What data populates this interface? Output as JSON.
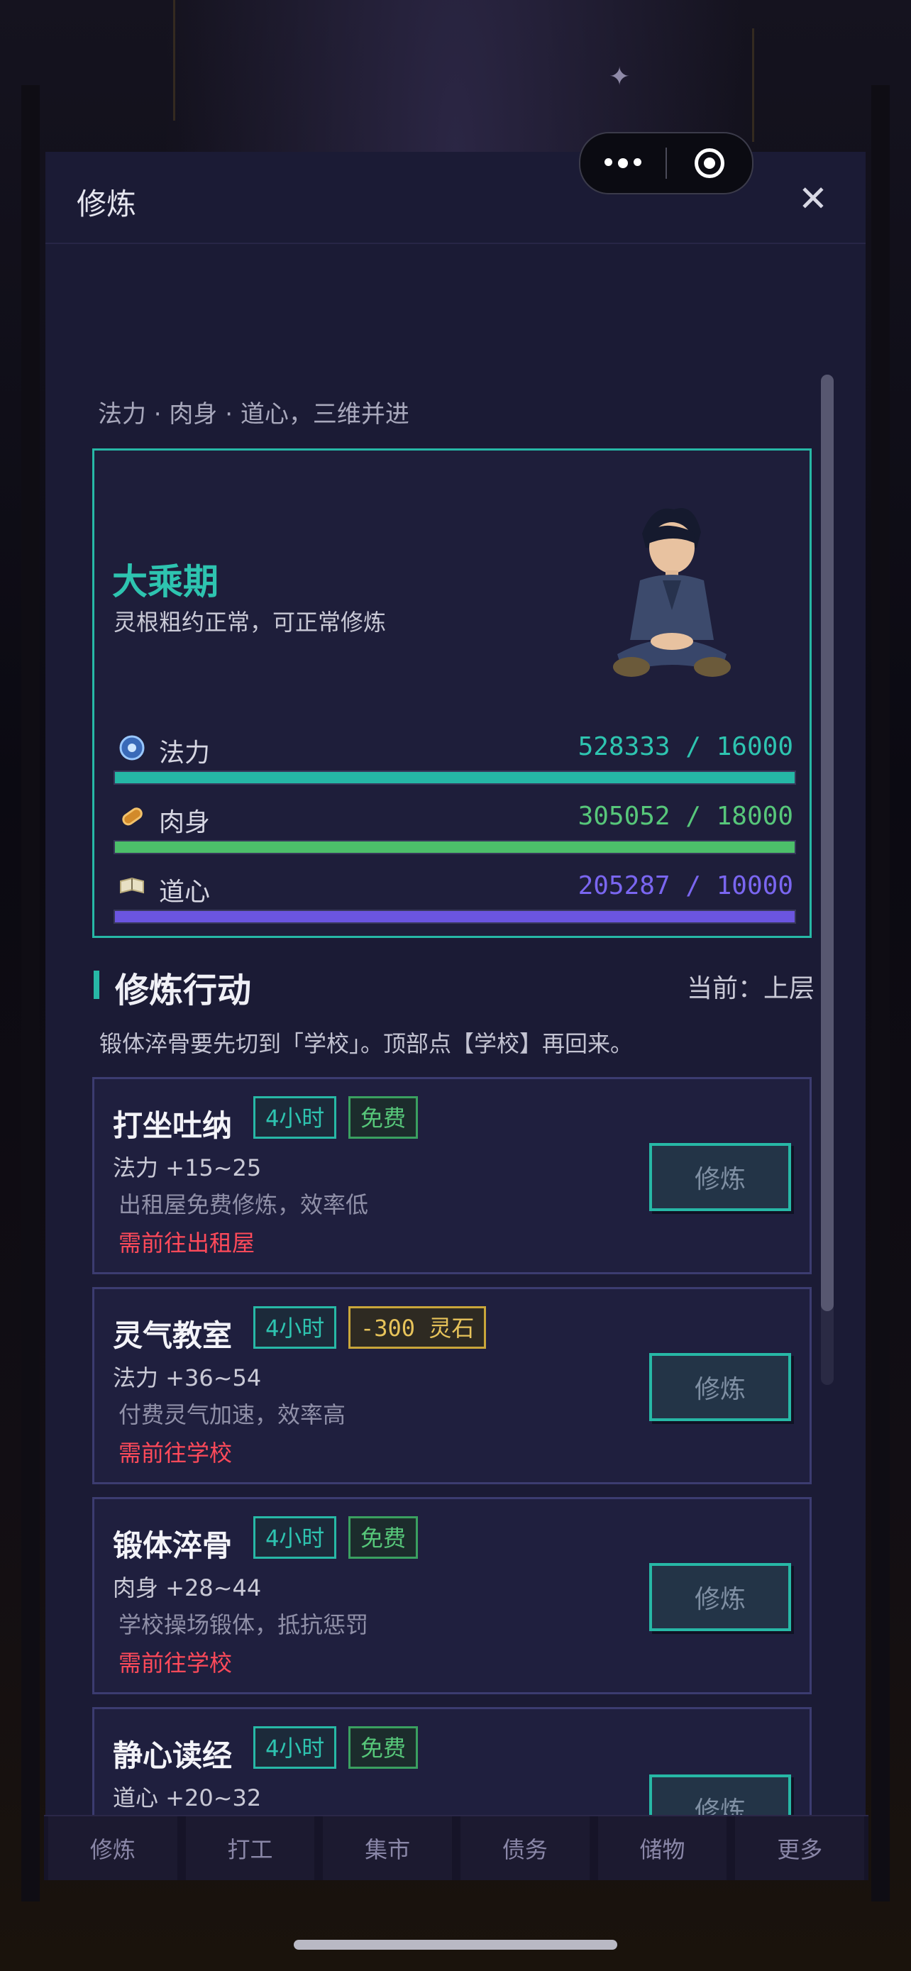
{
  "modal": {
    "title": "修炼",
    "subtitle": "法力 · 肉身 · 道心，三维并进"
  },
  "status": {
    "realm": "大乘期",
    "realm_desc": "灵根粗约正常，可正常修炼",
    "stats": [
      {
        "label": "法力",
        "value_text": "528333 / 16000",
        "fill": 1.0,
        "color": "#25b7a5",
        "icon": "mana-orb-icon"
      },
      {
        "label": "肉身",
        "value_text": "305052 / 18000",
        "fill": 1.0,
        "color": "#4cbf6a",
        "icon": "body-scroll-icon"
      },
      {
        "label": "道心",
        "value_text": "205287 / 10000",
        "fill": 1.0,
        "color": "#6b55e0",
        "icon": "dao-book-icon"
      }
    ],
    "value_colors": [
      "#2ec4b0",
      "#57c77a",
      "#7a66f0"
    ]
  },
  "actions": {
    "title": "修炼行动",
    "current": "当前：上层",
    "hint": "锻体淬骨要先切到「学校」。顶部点【学校】再回来。",
    "cards": [
      {
        "name": "打坐吐纳",
        "time": "4小时",
        "cost": "免费",
        "cost_type": "free",
        "gain": "法力 +15~25",
        "desc": "出租屋免费修炼，效率低",
        "req": "需前往出租屋",
        "button": "修炼"
      },
      {
        "name": "灵气教室",
        "time": "4小时",
        "cost": "-300 灵石",
        "cost_type": "paid",
        "gain": "法力 +36~54",
        "desc": "付费灵气加速，效率高",
        "req": "需前往学校",
        "button": "修炼"
      },
      {
        "name": "锻体淬骨",
        "time": "4小时",
        "cost": "免费",
        "cost_type": "free",
        "gain": "肉身 +28~44",
        "desc": "学校操场锻体，抵抗惩罚",
        "req": "需前往学校",
        "button": "修炼"
      },
      {
        "name": "静心读经",
        "time": "4小时",
        "cost": "免费",
        "cost_type": "free",
        "gain": "道心 +20~32",
        "desc": "",
        "req": "",
        "button": "修炼"
      }
    ]
  },
  "bottom_nav": [
    "修炼",
    "打工",
    "集市",
    "债务",
    "储物",
    "更多"
  ]
}
